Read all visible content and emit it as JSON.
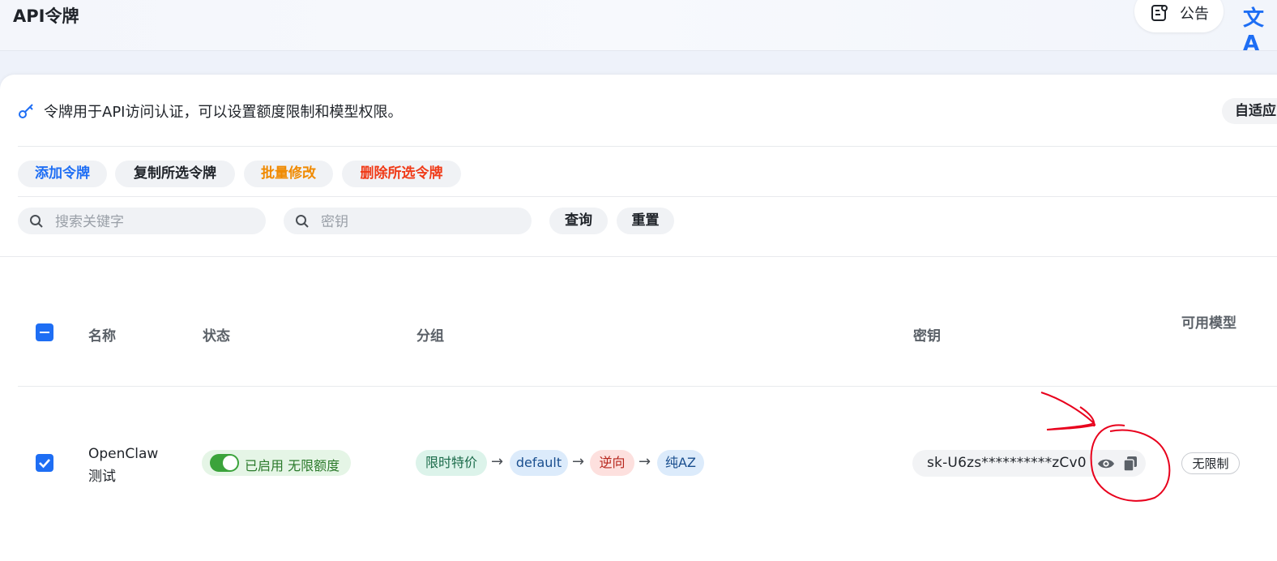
{
  "header": {
    "title": "API令牌",
    "announce_label": "公告",
    "lang_icon": "文A"
  },
  "info": {
    "text": "令牌用于API访问认证，可以设置额度限制和模型权限。",
    "adapt_label": "自适应"
  },
  "actions": {
    "add": "添加令牌",
    "copy_selected": "复制所选令牌",
    "batch_edit": "批量修改",
    "delete_selected": "删除所选令牌"
  },
  "filters": {
    "keyword_placeholder": "搜索关键字",
    "key_placeholder": "密钥",
    "query": "查询",
    "reset": "重置"
  },
  "table": {
    "headers": {
      "name": "名称",
      "status": "状态",
      "group": "分组",
      "key": "密钥",
      "models": "可用模型"
    },
    "rows": [
      {
        "name_line1": "OpenClaw",
        "name_line2": "测试",
        "status": "已启用 无限额度",
        "groups": [
          "限时特价",
          "default",
          "逆向",
          "纯AZ"
        ],
        "key": "sk-U6zs**********zCv0",
        "models": "无限制",
        "selected": true
      }
    ]
  },
  "colors": {
    "accent": "#1e6ef4",
    "batch_edit": "#f08a00",
    "delete": "#f03a17",
    "status_green": "#3ba33b",
    "annotation_red": "#e8001c"
  }
}
